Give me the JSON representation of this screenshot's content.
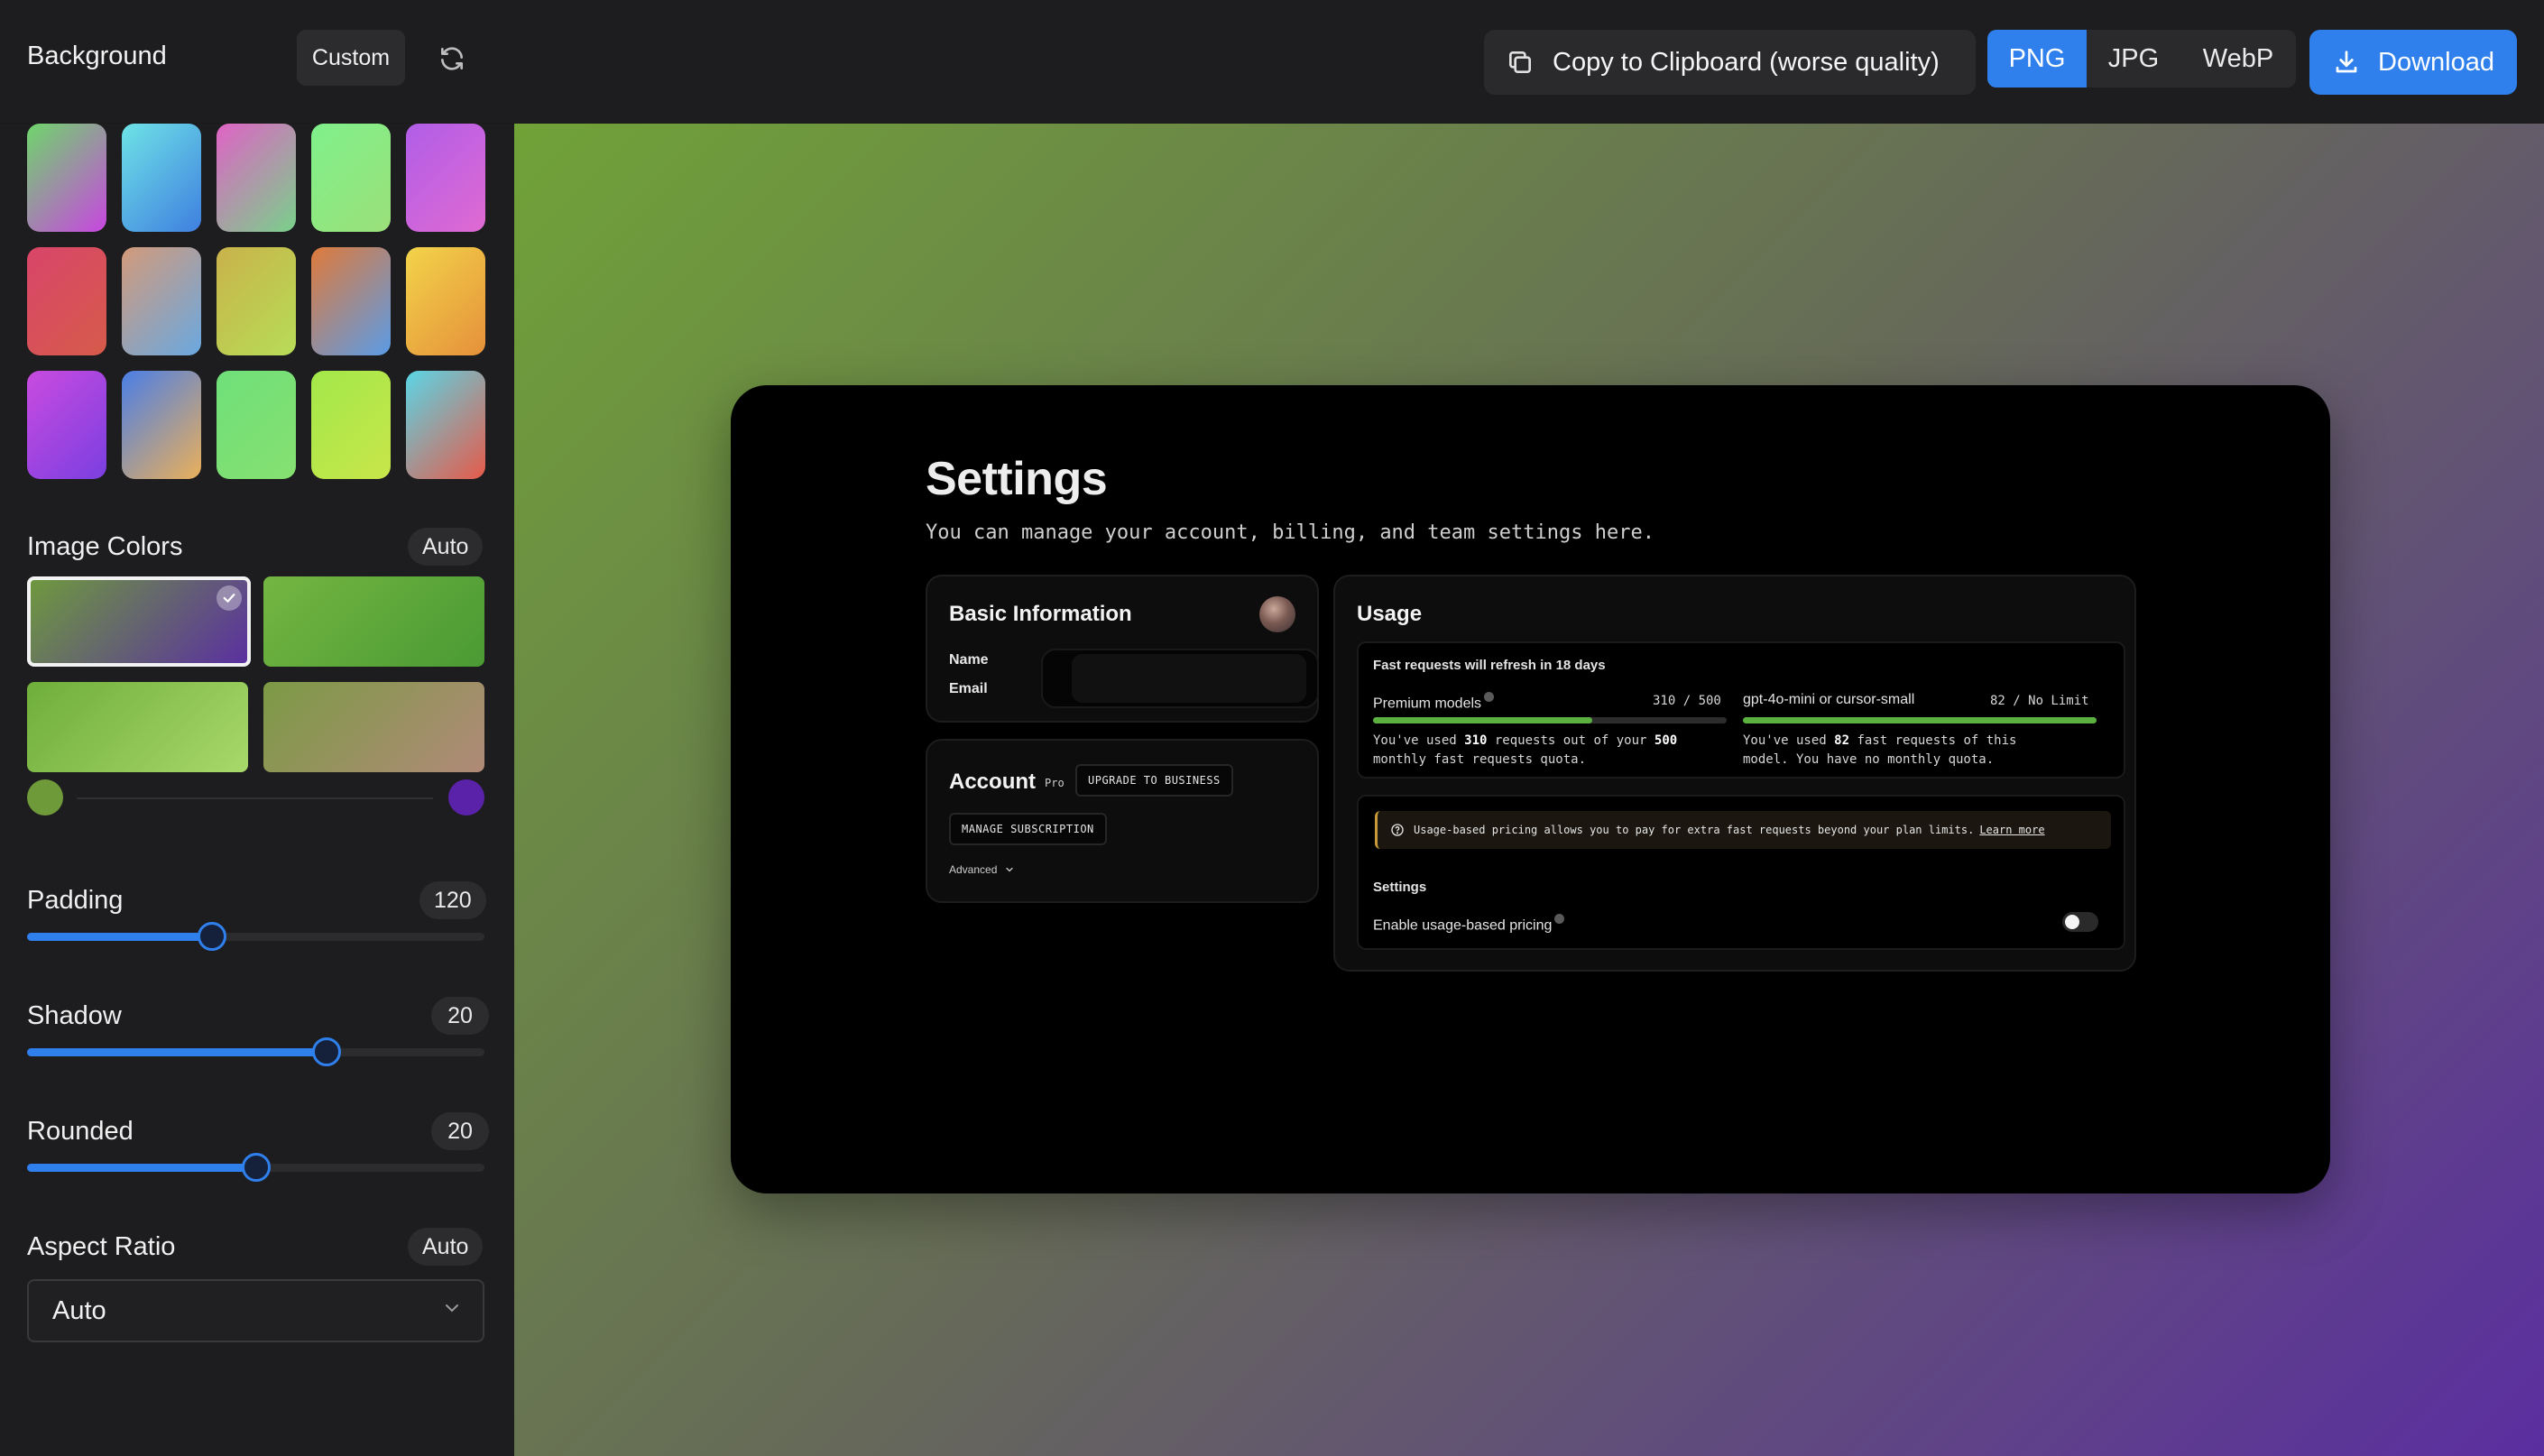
{
  "toolbar": {
    "background_label": "Background",
    "custom_label": "Custom",
    "copy_label": "Copy to Clipboard (worse quality)",
    "formats": [
      "PNG",
      "JPG",
      "WebP"
    ],
    "selected_format": "PNG",
    "download_label": "Download"
  },
  "sidebar": {
    "presets": [
      {
        "from": "#6fd66b",
        "to": "#c846e0"
      },
      {
        "from": "#6ee3e6",
        "to": "#3f7fe0"
      },
      {
        "from": "#e063c6",
        "to": "#79d08a"
      },
      {
        "from": "#7ff08a",
        "to": "#9be07a"
      },
      {
        "from": "#b05de8",
        "to": "#e06ad2"
      },
      {
        "from": "#d9456a",
        "to": "#d65b4a"
      },
      {
        "from": "#d39a7a",
        "to": "#6aa8e0"
      },
      {
        "from": "#c9b24a",
        "to": "#b7dd58"
      },
      {
        "from": "#e07a3a",
        "to": "#5a9be6"
      },
      {
        "from": "#f2d44a",
        "to": "#e6903a"
      },
      {
        "from": "#c94be0",
        "to": "#7a3fe0"
      },
      {
        "from": "#4a7ee6",
        "to": "#eab05a"
      },
      {
        "from": "#6fe07a",
        "to": "#86e070"
      },
      {
        "from": "#a3e84a",
        "to": "#c8e64a"
      },
      {
        "from": "#5ad6e6",
        "to": "#e65a4a"
      }
    ],
    "image_colors_label": "Image Colors",
    "image_colors_mode": "Auto",
    "image_colors": [
      {
        "from": "#6f9b3c",
        "to": "#5a2ea2"
      },
      {
        "from": "#74b642",
        "to": "#4a9a33"
      },
      {
        "from": "#6fae3a",
        "to": "#a8d86a"
      },
      {
        "from": "#7c9a45",
        "to": "#b08a78"
      }
    ],
    "gradient_start": "#6e9a3a",
    "gradient_end": "#5a22a8",
    "padding_label": "Padding",
    "padding_value": "120",
    "padding_fill": 0.405,
    "shadow_label": "Shadow",
    "shadow_value": "20",
    "shadow_fill": 0.655,
    "rounded_label": "Rounded",
    "rounded_value": "20",
    "rounded_fill": 0.5,
    "aspect_label": "Aspect Ratio",
    "aspect_mode": "Auto",
    "aspect_select": "Auto"
  },
  "preview": {
    "title": "Settings",
    "subtitle": "You can manage your account, billing, and team settings here.",
    "basic_info_title": "Basic Information",
    "name_label": "Name",
    "email_label": "Email",
    "account_title": "Account",
    "account_plan": "Pro",
    "upgrade_label": "UPGRADE TO BUSINESS",
    "manage_label": "MANAGE SUBSCRIPTION",
    "advanced_label": "Advanced",
    "usage_title": "Usage",
    "refresh_note": "Fast requests will refresh in 18 days",
    "premium_label": "Premium models",
    "premium_count": "310 / 500",
    "premium_fill": 0.62,
    "premium_desc_1": "You've used ",
    "premium_used": "310",
    "premium_desc_2": " requests out of your ",
    "premium_total": "500",
    "premium_desc_3": "monthly fast requests quota.",
    "mini_label": "gpt-4o-mini or cursor-small",
    "mini_count": "82 / No Limit",
    "mini_fill": 1.0,
    "mini_desc_1": "You've used ",
    "mini_used": "82",
    "mini_desc_2": " fast requests of this",
    "mini_desc_3": "model. You have no monthly quota.",
    "notice_text": "Usage-based pricing allows you to pay for extra fast requests beyond your plan limits.",
    "notice_link": "Learn more",
    "settings_label": "Settings",
    "usage_pricing_label": "Enable usage-based pricing"
  }
}
